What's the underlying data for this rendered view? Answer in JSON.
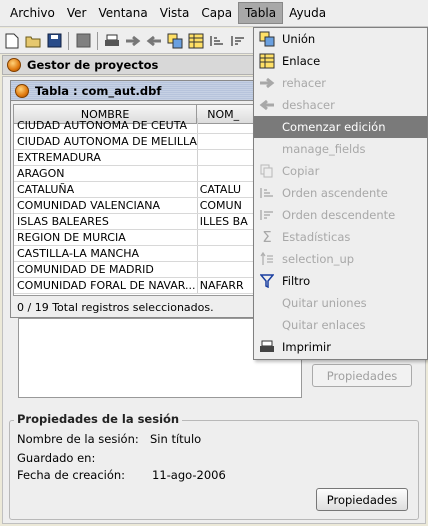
{
  "menubar": {
    "items": [
      "Archivo",
      "Ver",
      "Ventana",
      "Vista",
      "Capa",
      "Tabla",
      "Ayuda"
    ]
  },
  "project": {
    "title": "Gestor de proyectos",
    "properties_label": "Propiedades"
  },
  "table_window": {
    "title": "Tabla : com_aut.dbf",
    "columns": [
      "NOMBRE",
      "NOM_"
    ],
    "rows": [
      [
        "CIUDAD AUTONOMA DE CEUTA",
        ""
      ],
      [
        "CIUDAD AUTONOMA DE MELILLA",
        ""
      ],
      [
        "EXTREMADURA",
        ""
      ],
      [
        "ARAGON",
        ""
      ],
      [
        "CATALUÑA",
        "CATALU"
      ],
      [
        "COMUNIDAD VALENCIANA",
        "COMUN"
      ],
      [
        "ISLAS BALEARES",
        "ILLES BA"
      ],
      [
        "REGION DE MURCIA",
        ""
      ],
      [
        "CASTILLA-LA MANCHA",
        ""
      ],
      [
        "COMUNIDAD DE MADRID",
        ""
      ],
      [
        "COMUNIDAD FORAL DE NAVAR...",
        "NAFARR"
      ]
    ],
    "status": "0 / 19 Total registros seleccionados."
  },
  "session": {
    "title": "Propiedades de la sesión",
    "name_label": "Nombre de la sesión:",
    "name_value": "Sin título",
    "saved_label": "Guardado en:",
    "saved_value": "",
    "date_label": "Fecha de creación:",
    "date_value": "11-ago-2006",
    "properties_label": "Propiedades"
  },
  "dropdown": {
    "items": [
      {
        "label": "Unión",
        "icon": "union-icon",
        "enabled": true
      },
      {
        "label": "Enlace",
        "icon": "link-table-icon",
        "enabled": true
      },
      {
        "label": "rehacer",
        "icon": "redo-arrow-icon",
        "enabled": false
      },
      {
        "label": "deshacer",
        "icon": "undo-arrow-icon",
        "enabled": false
      },
      {
        "label": "Comenzar edición",
        "icon": "",
        "enabled": true,
        "highlighted": true
      },
      {
        "label": "manage_fields",
        "icon": "",
        "enabled": false
      },
      {
        "label": "Copiar",
        "icon": "copy-icon",
        "enabled": false
      },
      {
        "label": "Orden ascendente",
        "icon": "sort-ascending-icon",
        "enabled": false
      },
      {
        "label": "Orden descendente",
        "icon": "sort-descending-icon",
        "enabled": false
      },
      {
        "label": "Estadísticas",
        "icon": "sigma-icon",
        "enabled": false
      },
      {
        "label": "selection_up",
        "icon": "selection-up-icon",
        "enabled": false
      },
      {
        "label": "Filtro",
        "icon": "filter-icon",
        "enabled": true
      },
      {
        "label": "Quitar uniones",
        "icon": "",
        "enabled": false
      },
      {
        "label": "Quitar enlaces",
        "icon": "",
        "enabled": false
      },
      {
        "label": "Imprimir",
        "icon": "printer-icon",
        "enabled": true
      }
    ]
  }
}
